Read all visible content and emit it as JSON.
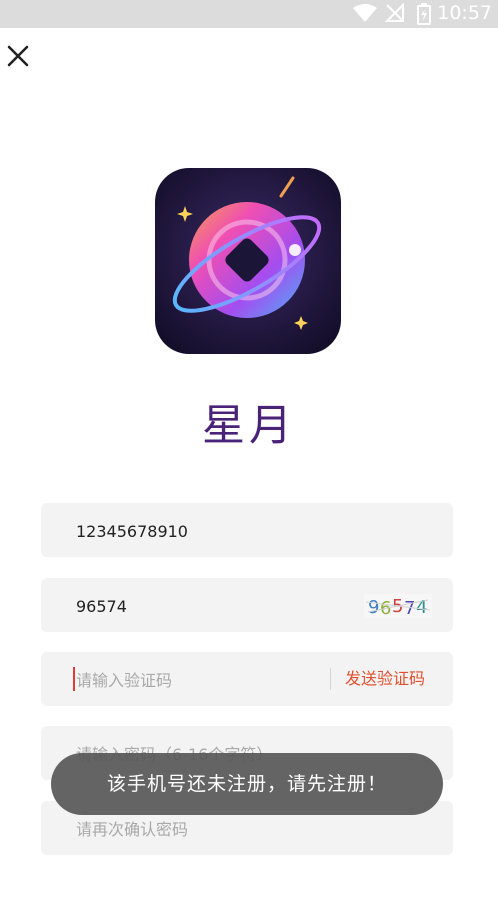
{
  "status_bar": {
    "time": "10:57",
    "icons": [
      "wifi-icon",
      "no-signal-icon",
      "battery-charging-icon"
    ]
  },
  "header": {
    "close_icon": "close-icon"
  },
  "app": {
    "name": "星月",
    "logo": "planet-logo"
  },
  "form": {
    "phone": {
      "value": "12345678910"
    },
    "captcha_input": {
      "value": "96574"
    },
    "captcha_image": {
      "text": "96574"
    },
    "sms_code": {
      "placeholder": "请输入验证码",
      "value": ""
    },
    "send_code_label": "发送验证码",
    "password": {
      "placeholder": "请输入密码（6-16个字符）",
      "value": ""
    },
    "confirm_password": {
      "placeholder": "请再次确认密码",
      "value": ""
    }
  },
  "toast": {
    "message": "该手机号还未注册，请先注册！"
  },
  "colors": {
    "accent": "#e0502f",
    "brand": "#4a2378",
    "field_bg": "#f3f3f3",
    "toast_bg": "#585858"
  }
}
